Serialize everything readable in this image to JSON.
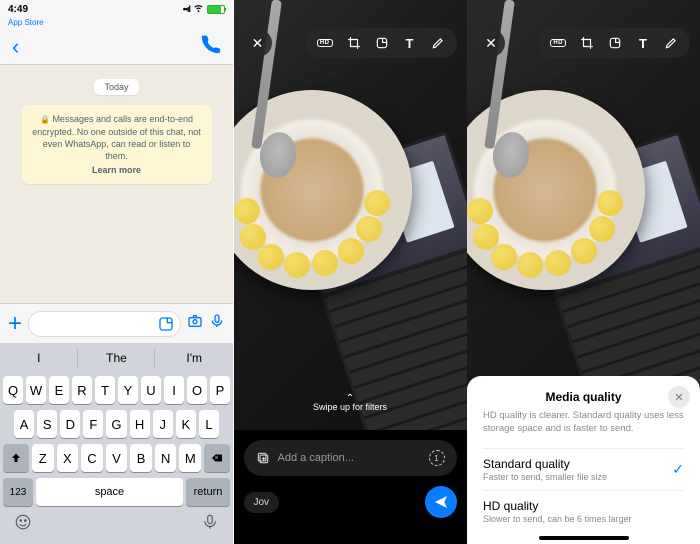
{
  "status": {
    "time": "4:49",
    "appstore": "App Store"
  },
  "chat": {
    "day": "Today",
    "encryption": "Messages and calls are end-to-end encrypted. No one outside of this chat, not even WhatsApp, can read or listen to them.",
    "learn_more": "Learn more"
  },
  "predictions": [
    "I",
    "The",
    "I'm"
  ],
  "keys": {
    "row1": [
      "Q",
      "W",
      "E",
      "R",
      "T",
      "Y",
      "U",
      "I",
      "O",
      "P"
    ],
    "row2": [
      "A",
      "S",
      "D",
      "F",
      "G",
      "H",
      "J",
      "K",
      "L"
    ],
    "row3": [
      "Z",
      "X",
      "C",
      "V",
      "B",
      "N",
      "M"
    ],
    "num": "123",
    "space": "space",
    "ret": "return"
  },
  "editor": {
    "hd": "HD",
    "swipe": "Swipe up for filters",
    "caption_placeholder": "Add a caption...",
    "recipient": "Jov"
  },
  "sheet": {
    "title": "Media quality",
    "desc": "HD quality is clearer. Standard quality uses less storage space and is faster to send.",
    "opt1": {
      "title": "Standard quality",
      "sub": "Faster to send, smaller file size"
    },
    "opt2": {
      "title": "HD quality",
      "sub": "Slower to send, can be 6 times larger"
    }
  }
}
